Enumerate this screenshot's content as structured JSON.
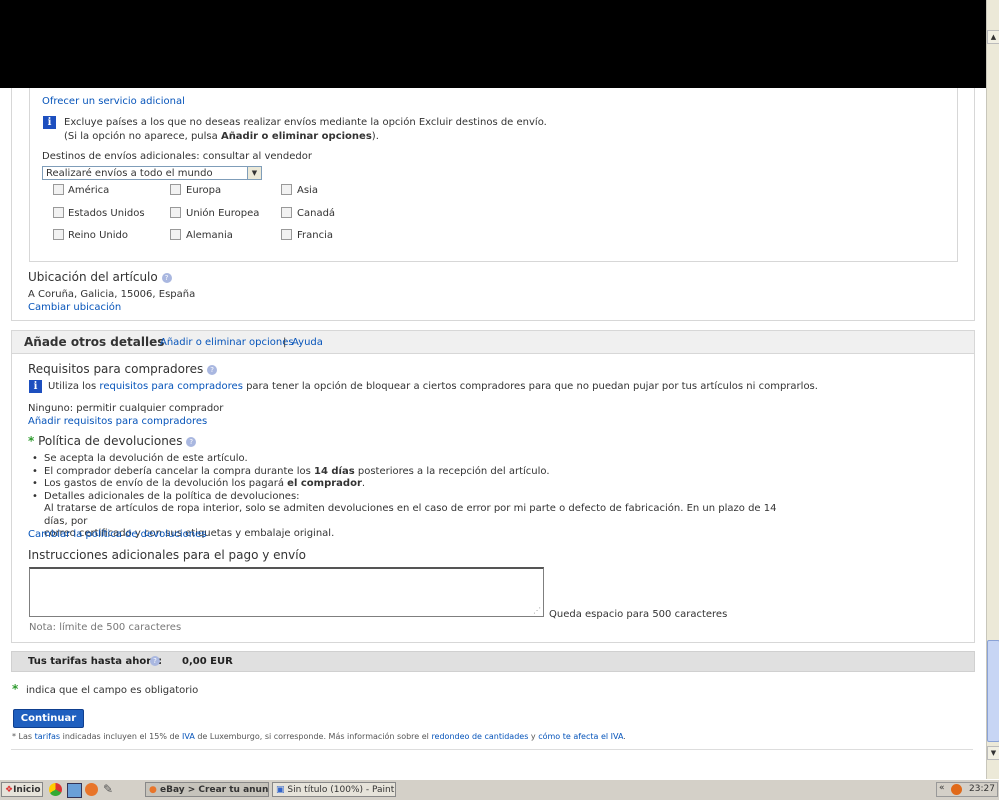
{
  "shipping": {
    "offer_additional_service": "Ofrecer un servicio adicional",
    "exclude_info_line1": "Excluye países a los que no deseas realizar envíos mediante la opción Excluir destinos de envío.",
    "exclude_info_line2_pre": "(Si la opción no aparece, pulsa ",
    "exclude_info_line2_bold": "Añadir o eliminar opciones",
    "exclude_info_line2_post": ").",
    "destinations_label": "Destinos de envíos adicionales: consultar al vendedor",
    "destinations_select_value": "Realizaré envíos a todo el mundo",
    "checkboxes": [
      "América",
      "Europa",
      "Asia",
      "Estados Unidos",
      "Unión Europea",
      "Canadá",
      "Reino Unido",
      "Alemania",
      "Francia"
    ]
  },
  "location": {
    "title": "Ubicación del artículo",
    "value": "A Coruña, Galicia, 15006, España",
    "change_link": "Cambiar ubicación"
  },
  "other_details": {
    "title": "Añade otros detalles",
    "add_remove_link": "Añadir o eliminar opciones",
    "separator": "|",
    "help_link": "Ayuda"
  },
  "buyer_requirements": {
    "title": "Requisitos para compradores",
    "info_pre": "Utiliza los ",
    "info_link": "requisitos para compradores",
    "info_post": " para tener la opción de bloquear a ciertos compradores para que no puedan pujar por tus artículos ni comprarlos.",
    "value": "Ninguno: permitir cualquier comprador",
    "add_link": "Añadir requisitos para compradores"
  },
  "returns": {
    "required_mark": "*",
    "title": "Política de devoluciones",
    "item1": "Se acepta la devolución de este artículo.",
    "item2_pre": "El comprador debería cancelar la compra durante los ",
    "item2_bold": "14 días",
    "item2_post": " posteriores a la recepción del artículo.",
    "item3_pre": "Los gastos de envío de la devolución los pagará ",
    "item3_bold": "el comprador",
    "item3_post": ".",
    "item4": "Detalles adicionales de la política de devoluciones:",
    "details_line1": "Al tratarse de artículos de ropa interior, solo se admiten devoluciones en el caso de error por mi parte o defecto de fabricación. En un plazo de 14 días, por",
    "details_line2": "correo certificado y con sus etiquetas y embalaje original.",
    "change_link": "Cambiar la política de devoluciones"
  },
  "instructions": {
    "title": "Instrucciones adicionales para el pago y envío",
    "remaining": "Queda espacio para 500 caracteres",
    "note": "Nota: límite de 500 caracteres"
  },
  "fees": {
    "label": "Tus tarifas hasta ahora:",
    "value": "0,00 EUR"
  },
  "required_note": {
    "mark": "*",
    "text": "indica que el campo es obligatorio"
  },
  "continue_label": "Continuar",
  "footnote": {
    "p1": "* Las ",
    "link1": "tarifas",
    "p2": " indicadas incluyen el 15% de ",
    "link2": "IVA",
    "p3": " de Luxemburgo, si corresponde. Más información sobre el ",
    "link3": "redondeo de cantidades",
    "p4": " y ",
    "link4": "cómo te afecta el IVA",
    "p5": "."
  },
  "taskbar": {
    "start_label": "Inicio",
    "task1": "eBay > Crear tu anun...",
    "task2": "Sin título (100%) - Paint....",
    "clock": "23:27"
  },
  "colors": {
    "link": "#0654ba",
    "accent_button": "#1f5fbf",
    "required_green": "#2e9b2e"
  }
}
